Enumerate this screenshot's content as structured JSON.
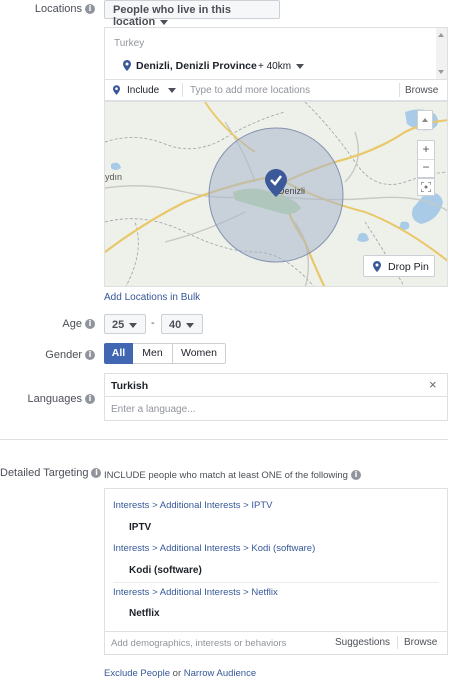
{
  "locations": {
    "label": "Locations",
    "dropdown": "People who live in this location",
    "country": "Turkey",
    "location": "Denizli, Denizli Province",
    "radius": "+ 40km",
    "include": "Include",
    "placeholder": "Type to add more locations",
    "browse": "Browse",
    "map_city": "Denizli",
    "map_west": "ydın",
    "drop_pin": "Drop Pin",
    "zoom_in": "+",
    "zoom_out": "−",
    "bulk_link": "Add Locations in Bulk"
  },
  "age": {
    "label": "Age",
    "min": "25",
    "max": "40",
    "sep": "-"
  },
  "gender": {
    "label": "Gender",
    "options": [
      "All",
      "Men",
      "Women"
    ],
    "selected": "All"
  },
  "languages": {
    "label": "Languages",
    "value": "Turkish",
    "placeholder": "Enter a language..."
  },
  "detailed": {
    "label": "Detailed Targeting",
    "description": "INCLUDE people who match at least ONE of the following",
    "groups": [
      {
        "path": [
          "Interests",
          "Additional Interests",
          "IPTV"
        ],
        "item": "IPTV"
      },
      {
        "path": [
          "Interests",
          "Additional Interests",
          "Kodi (software)"
        ],
        "item": "Kodi (software)"
      },
      {
        "path": [
          "Interests",
          "Additional Interests",
          "Netflix"
        ],
        "item": "Netflix"
      }
    ],
    "placeholder": "Add demographics, interests or behaviors",
    "suggestions": "Suggestions",
    "browse": "Browse",
    "exclude": "Exclude People",
    "or": "or",
    "narrow": "Narrow Audience"
  },
  "colors": {
    "accent": "#4267b2",
    "link": "#365899",
    "pin": "#3b5998",
    "map_bg": "#eef0ea",
    "radius_fill": "#a9b7cc"
  }
}
